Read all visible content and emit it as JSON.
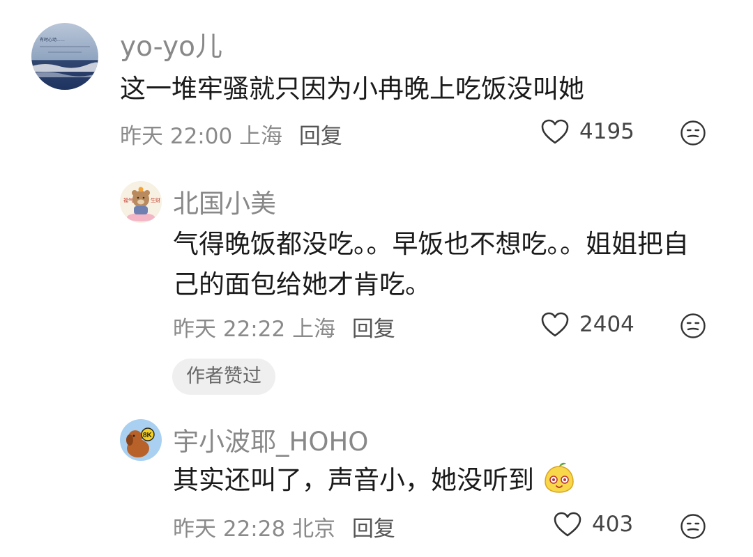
{
  "comments": [
    {
      "username": "yo-yo儿",
      "text": "这一堆牢骚就只因为小冉晚上吃饭没叫她",
      "date": "昨天",
      "time": "22:00",
      "location": "上海",
      "reply_label": "回复",
      "likes": "4195",
      "avatar_text": "有时心动……"
    },
    {
      "username": "北国小美",
      "text": "气得晚饭都没吃。。早饭也不想吃。。姐姐把自己的面包给她才肯吃。",
      "date": "昨天",
      "time": "22:22",
      "location": "上海",
      "reply_label": "回复",
      "likes": "2404",
      "badge": "作者赞过",
      "avatar_text_left": "福气",
      "avatar_text_right": "生财"
    },
    {
      "username": "宇小波耶_HOHO",
      "text": "其实还叫了，声音小，她没听到",
      "date": "昨天",
      "time": "22:28",
      "location": "北京",
      "reply_label": "回复",
      "likes": "403",
      "avatar_badge": "8K"
    }
  ],
  "icons": {
    "like": "heart-outline-icon",
    "dislike": "meh-face-icon"
  },
  "colors": {
    "username": "#888888",
    "meta": "#8a8a8a",
    "badge_bg": "#efefef"
  }
}
